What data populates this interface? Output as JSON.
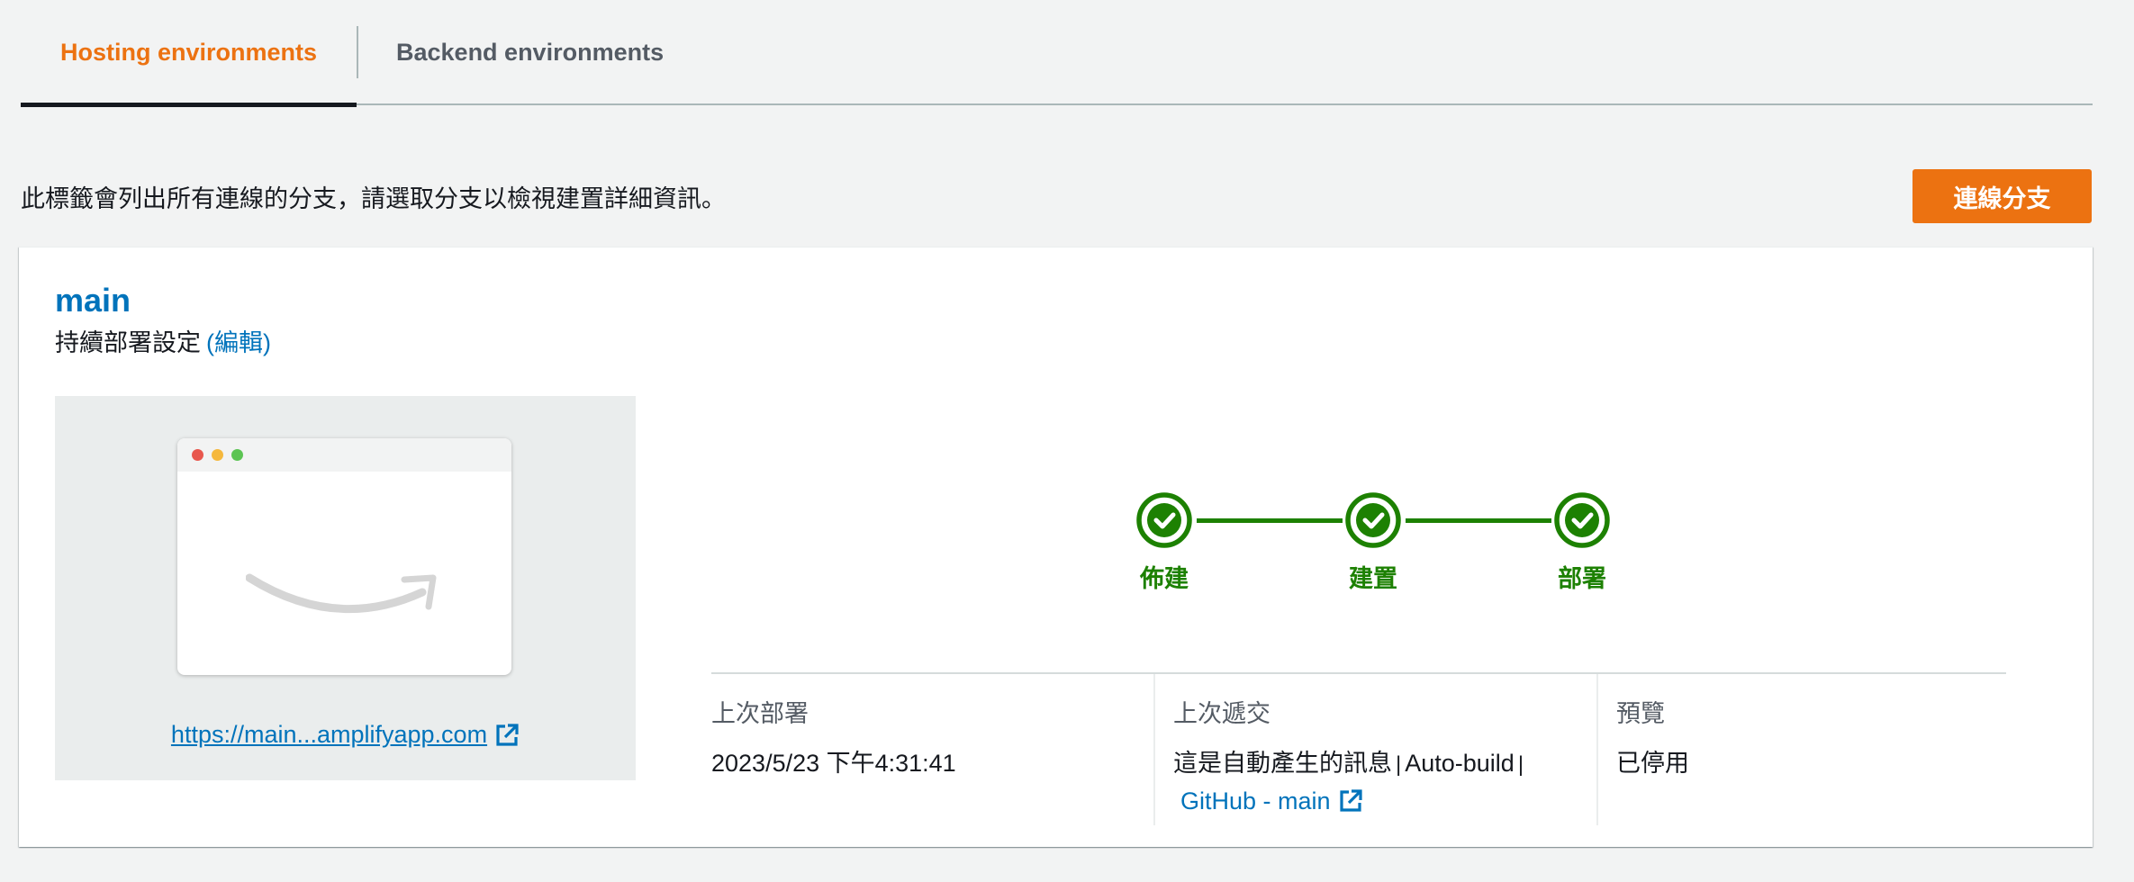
{
  "tabs": {
    "hosting": "Hosting environments",
    "backend": "Backend environments"
  },
  "intro_text": "此標籤會列出所有連線的分支，請選取分支以檢視建置詳細資訊。",
  "connect_button": "連線分支",
  "branch": {
    "name": "main",
    "cd_label": "持續部署設定",
    "edit_label": "(編輯)",
    "preview_url": "https://main...amplifyapp.com",
    "pipeline": {
      "steps": [
        "佈建",
        "建置",
        "部署"
      ],
      "status": "succeeded",
      "color": "#1d8102"
    },
    "last_deploy": {
      "label": "上次部署",
      "value": "2023/5/23 下午4:31:41"
    },
    "last_commit": {
      "label": "上次遞交",
      "message": "這是自動產生的訊息",
      "sep": "|",
      "type": "Auto-build",
      "repo_link": "GitHub - main"
    },
    "preview": {
      "label": "預覽",
      "value": "已停用"
    }
  },
  "colors": {
    "accent": "#ec7211",
    "link": "#0073bb",
    "success": "#1d8102"
  },
  "icons": {
    "external_link": "external-link-icon",
    "check": "check-circle-icon"
  }
}
